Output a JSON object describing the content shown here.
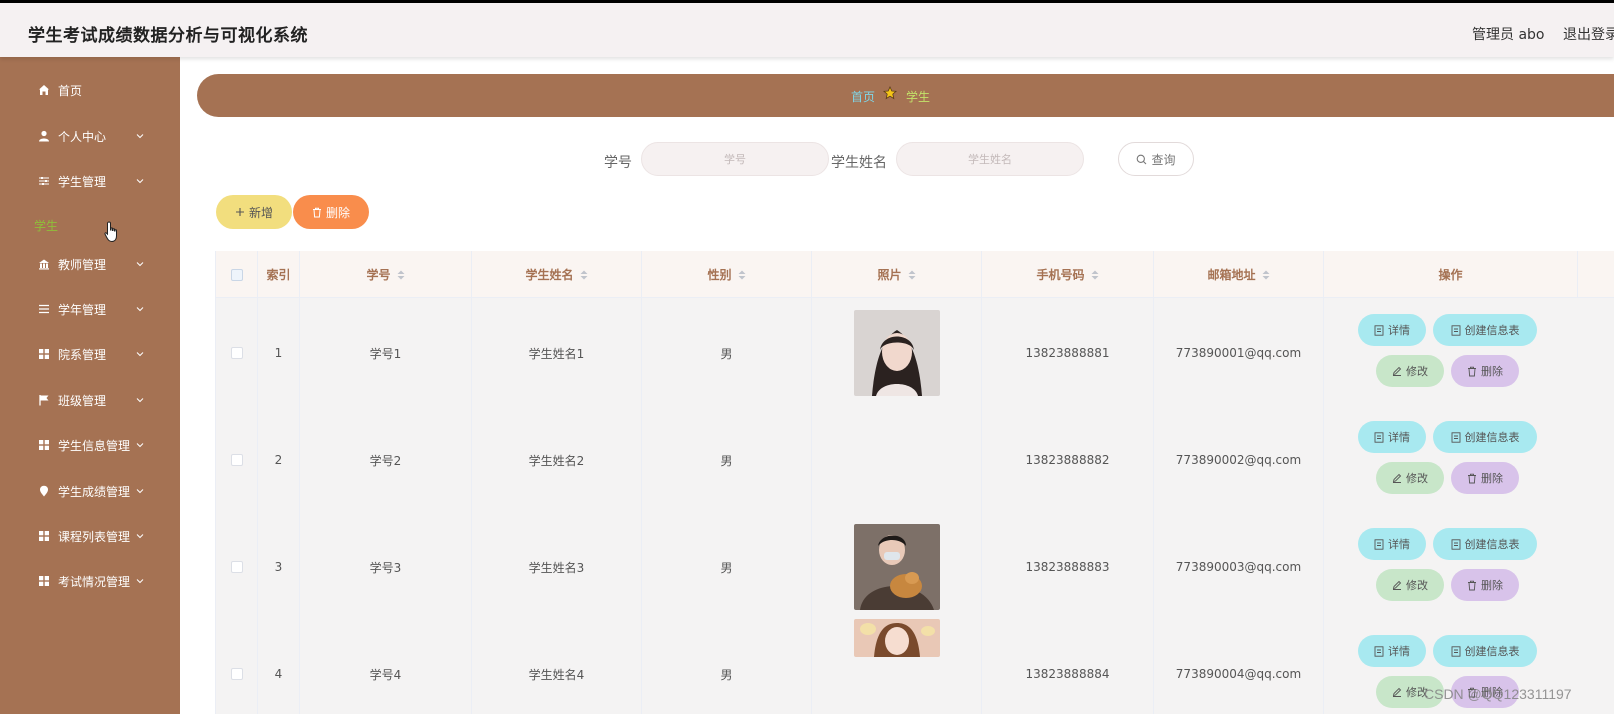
{
  "header": {
    "title": "学生考试成绩数据分析与可视化系统",
    "admin": "管理员 abo",
    "logout": "退出登录"
  },
  "sidebar": {
    "items": [
      {
        "label": "首页",
        "icon": "home-icon"
      },
      {
        "label": "个人中心",
        "icon": "user-icon"
      },
      {
        "label": "学生管理",
        "icon": "sliders-icon"
      },
      {
        "label": "教师管理",
        "icon": "bank-icon"
      },
      {
        "label": "学年管理",
        "icon": "list-icon"
      },
      {
        "label": "院系管理",
        "icon": "grid-icon"
      },
      {
        "label": "班级管理",
        "icon": "flag-icon"
      },
      {
        "label": "学生信息管理",
        "icon": "grid-icon"
      },
      {
        "label": "学生成绩管理",
        "icon": "location-icon"
      },
      {
        "label": "课程列表管理",
        "icon": "grid-icon"
      },
      {
        "label": "考试情况管理",
        "icon": "grid-icon"
      }
    ],
    "active_sub": "学生"
  },
  "breadcrumb": {
    "home": "首页",
    "current": "学生"
  },
  "search": {
    "id_label": "学号",
    "id_placeholder": "学号",
    "name_label": "学生姓名",
    "name_placeholder": "学生姓名",
    "query": "查询"
  },
  "actions": {
    "add": "新增",
    "delete": "删除"
  },
  "table": {
    "headers": [
      "索引",
      "学号",
      "学生姓名",
      "性别",
      "照片",
      "手机号码",
      "邮箱地址",
      "操作"
    ],
    "rows": [
      {
        "index": "1",
        "id": "学号1",
        "name": "学生姓名1",
        "gender": "男",
        "phone": "13823888881",
        "email": "773890001@qq.com"
      },
      {
        "index": "2",
        "id": "学号2",
        "name": "学生姓名2",
        "gender": "男",
        "phone": "13823888882",
        "email": "773890002@qq.com"
      },
      {
        "index": "3",
        "id": "学号3",
        "name": "学生姓名3",
        "gender": "男",
        "phone": "13823888883",
        "email": "773890003@qq.com"
      },
      {
        "index": "4",
        "id": "学号4",
        "name": "学生姓名4",
        "gender": "男",
        "phone": "13823888884",
        "email": "773890004@qq.com"
      }
    ],
    "ops": {
      "detail": "详情",
      "create": "创建信息表",
      "edit": "修改",
      "remove": "删除"
    }
  },
  "watermark": "CSDN @QQ123311197"
}
